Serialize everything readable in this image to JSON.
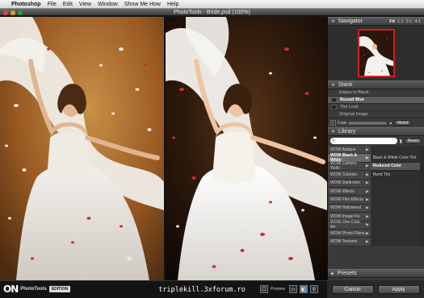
{
  "menubar": {
    "app_name": "Photoshop",
    "items": [
      "File",
      "Edit",
      "View",
      "Window",
      "Show Me How",
      "Help"
    ]
  },
  "window": {
    "title": "PhotoTools - Bride.psd (100%)"
  },
  "navigator": {
    "title": "Navigator",
    "zoom_options": [
      "Fit",
      "1:1",
      "2:1",
      "4:1"
    ],
    "active_zoom": "Fit",
    "frame_color": "#d21f1f"
  },
  "stack": {
    "title": "Stack",
    "rows": [
      {
        "label": "Edges to Black",
        "selected": false,
        "has_box": false
      },
      {
        "label": "Round Blur",
        "selected": true,
        "has_box": true
      },
      {
        "label": "The Look",
        "selected": false,
        "has_box": true
      },
      {
        "label": "Original Image",
        "selected": false,
        "has_box": false
      }
    ],
    "fade_label": "Fade",
    "reset_label": "Reset"
  },
  "library": {
    "title": "Library",
    "search_placeholder": "",
    "reset_label": "Reset",
    "categories": [
      "WOW Antique",
      "WOW Black & White",
      "WOW Camera Tools",
      "WOW Colorize",
      "WOW Darkroom",
      "WOW Effects",
      "WOW Film Effects",
      "WOW Hollywood",
      "WOW Image Fix",
      "WOW One-Click Art",
      "WOW Photo Filters",
      "WOW Textures"
    ],
    "selected_category": "WOW Black & White",
    "items": [
      "Black & White Color Tint",
      "Reduced Color",
      "Hand Tint"
    ],
    "selected_item": "Reduced Color"
  },
  "presets": {
    "title": "Presets"
  },
  "bottom": {
    "logo_mark": "ON",
    "logo_text": "PhotoTools",
    "edition": "EDITION",
    "watermark": "triplekill.3xforum.ro",
    "preview_label": "Preview",
    "cancel_label": "Cancel",
    "apply_label": "Apply"
  },
  "colors": {
    "panel_bg": "#3a3a3a",
    "selected_row": "#6a6a6a",
    "dress": "#e8e6e2",
    "background_warm": "#9a5a22"
  }
}
